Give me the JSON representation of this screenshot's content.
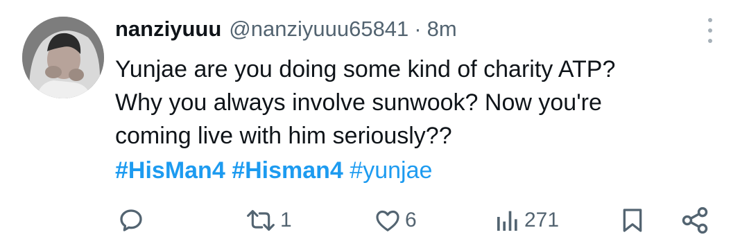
{
  "tweet": {
    "display_name": "nanziyuuu",
    "handle": "@nanziyuuu65841",
    "separator": "·",
    "time": "8m",
    "body_lines": [
      "Yunjae are you doing some kind of charity ATP?",
      "Why you always involve sunwook? Now you're",
      "coming live with him seriously??"
    ],
    "hashtags": [
      "#HisMan4",
      "#Hisman4",
      "#yunjae"
    ]
  },
  "actions": {
    "reply_icon": "reply-icon",
    "retweet_icon": "retweet-icon",
    "retweet_count": "1",
    "like_icon": "heart-icon",
    "like_count": "6",
    "views_icon": "views-chart-icon",
    "views_count": "271",
    "bookmark_icon": "bookmark-icon",
    "share_icon": "share-icon"
  },
  "colors": {
    "text": "#0f1419",
    "secondary": "#536471",
    "accent": "#1d9bf0"
  }
}
